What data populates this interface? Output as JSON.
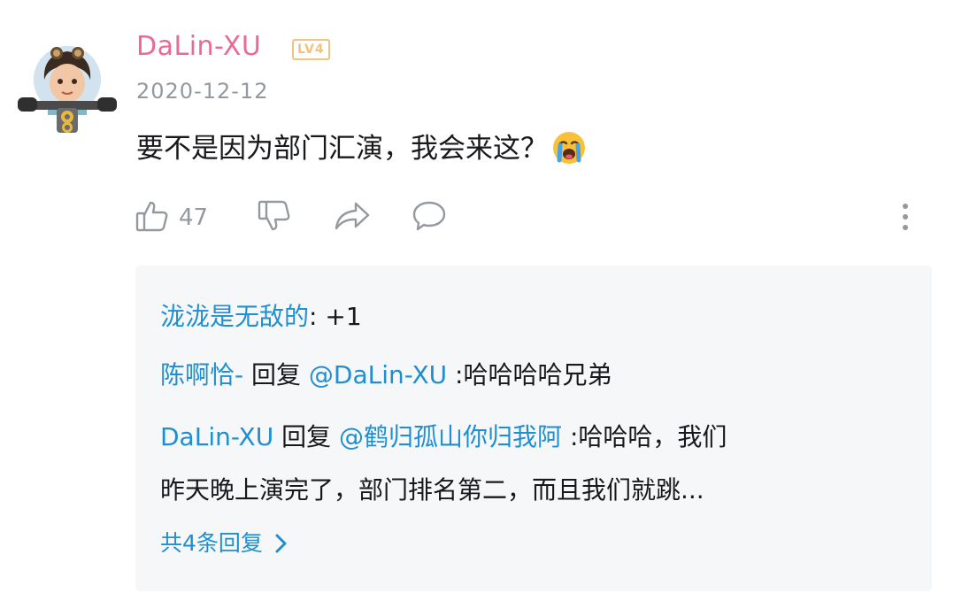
{
  "comment": {
    "username": "DaLin-XU",
    "level": "LV4",
    "date": "2020-12-12",
    "text": "要不是因为部门汇演，我会来这？",
    "emoji": "crying-face-emoji"
  },
  "actions": {
    "like_count": "47",
    "icons": [
      "thumbs-up-icon",
      "thumbs-down-icon",
      "share-icon",
      "reply-icon",
      "more-icon"
    ]
  },
  "replies": [
    {
      "name": "泷泷是无敌的",
      "separator": ":",
      "text": " +1"
    },
    {
      "name": "陈啊恰-",
      "reply_word": " 回复 ",
      "mention": "@DaLin-XU",
      "text": " :哈哈哈哈兄弟"
    },
    {
      "name": "DaLin-XU",
      "reply_word": " 回复 ",
      "mention": "@鹤归孤山你归我阿",
      "text": " :哈哈哈，我们",
      "text_line2": "昨天晚上演完了，部门排名第二，而且我们就跳..."
    }
  ],
  "more_replies": {
    "label": "共4条回复"
  },
  "colors": {
    "username_pink": "#e96a96",
    "level_gold": "#f3c27d",
    "link_blue": "#1f8fd1",
    "meta_gray": "#9499a0",
    "panel_bg": "#f6f7f8"
  }
}
